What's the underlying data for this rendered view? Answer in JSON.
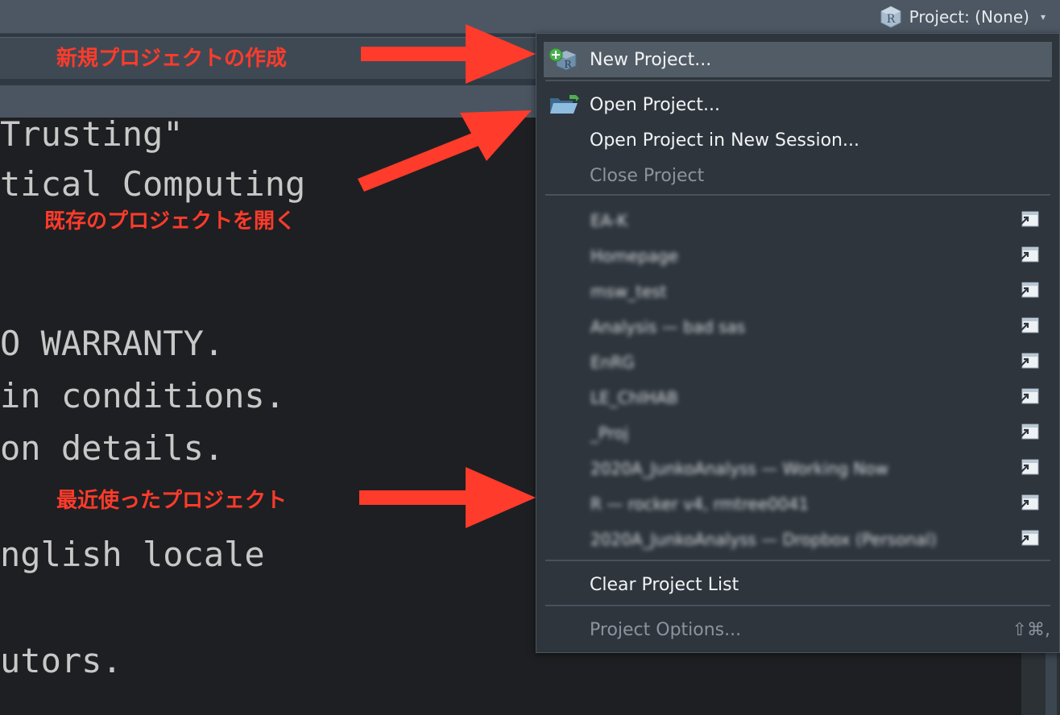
{
  "toolbar": {
    "project_status": "Project: (None)",
    "r_icon_letter": "R",
    "chevron": "▾"
  },
  "console": {
    "lines": [
      "Trusting\"",
      "tical Computing",
      "O WARRANTY.",
      "in conditions.",
      "on details.",
      "nglish locale",
      "utors."
    ]
  },
  "annotations": {
    "new_project": "新規プロジェクトの作成",
    "open_project": "既存のプロジェクトを開く",
    "recent_projects": "最近使ったプロジェクト",
    "color": "#ff3b2b"
  },
  "menu": {
    "new_project": "New Project...",
    "open_project": "Open Project...",
    "open_in_new_session": "Open Project in New Session...",
    "close_project": "Close Project",
    "recent": [
      "EA-K",
      "Homepage",
      "msw_test",
      "Analysis — bad sas",
      "EnRG",
      "LE_ChIHAB",
      "_Proj",
      "2020A_JunkoAnalyss — Working Now",
      "R — rocker v4, rmtree0041",
      "2020A_JunkoAnalyss — Dropbox (Personal)"
    ],
    "clear_list": "Clear Project List",
    "project_options": "Project Options...",
    "project_options_shortcut": "⇧⌘,"
  },
  "colors": {
    "menu_bg": "#2e353d",
    "highlight": "#525c66",
    "toolbar": "#4c5763",
    "console_bg": "#1e1f22",
    "console_text": "#c8c8c8",
    "disabled_text": "#8b949d"
  }
}
